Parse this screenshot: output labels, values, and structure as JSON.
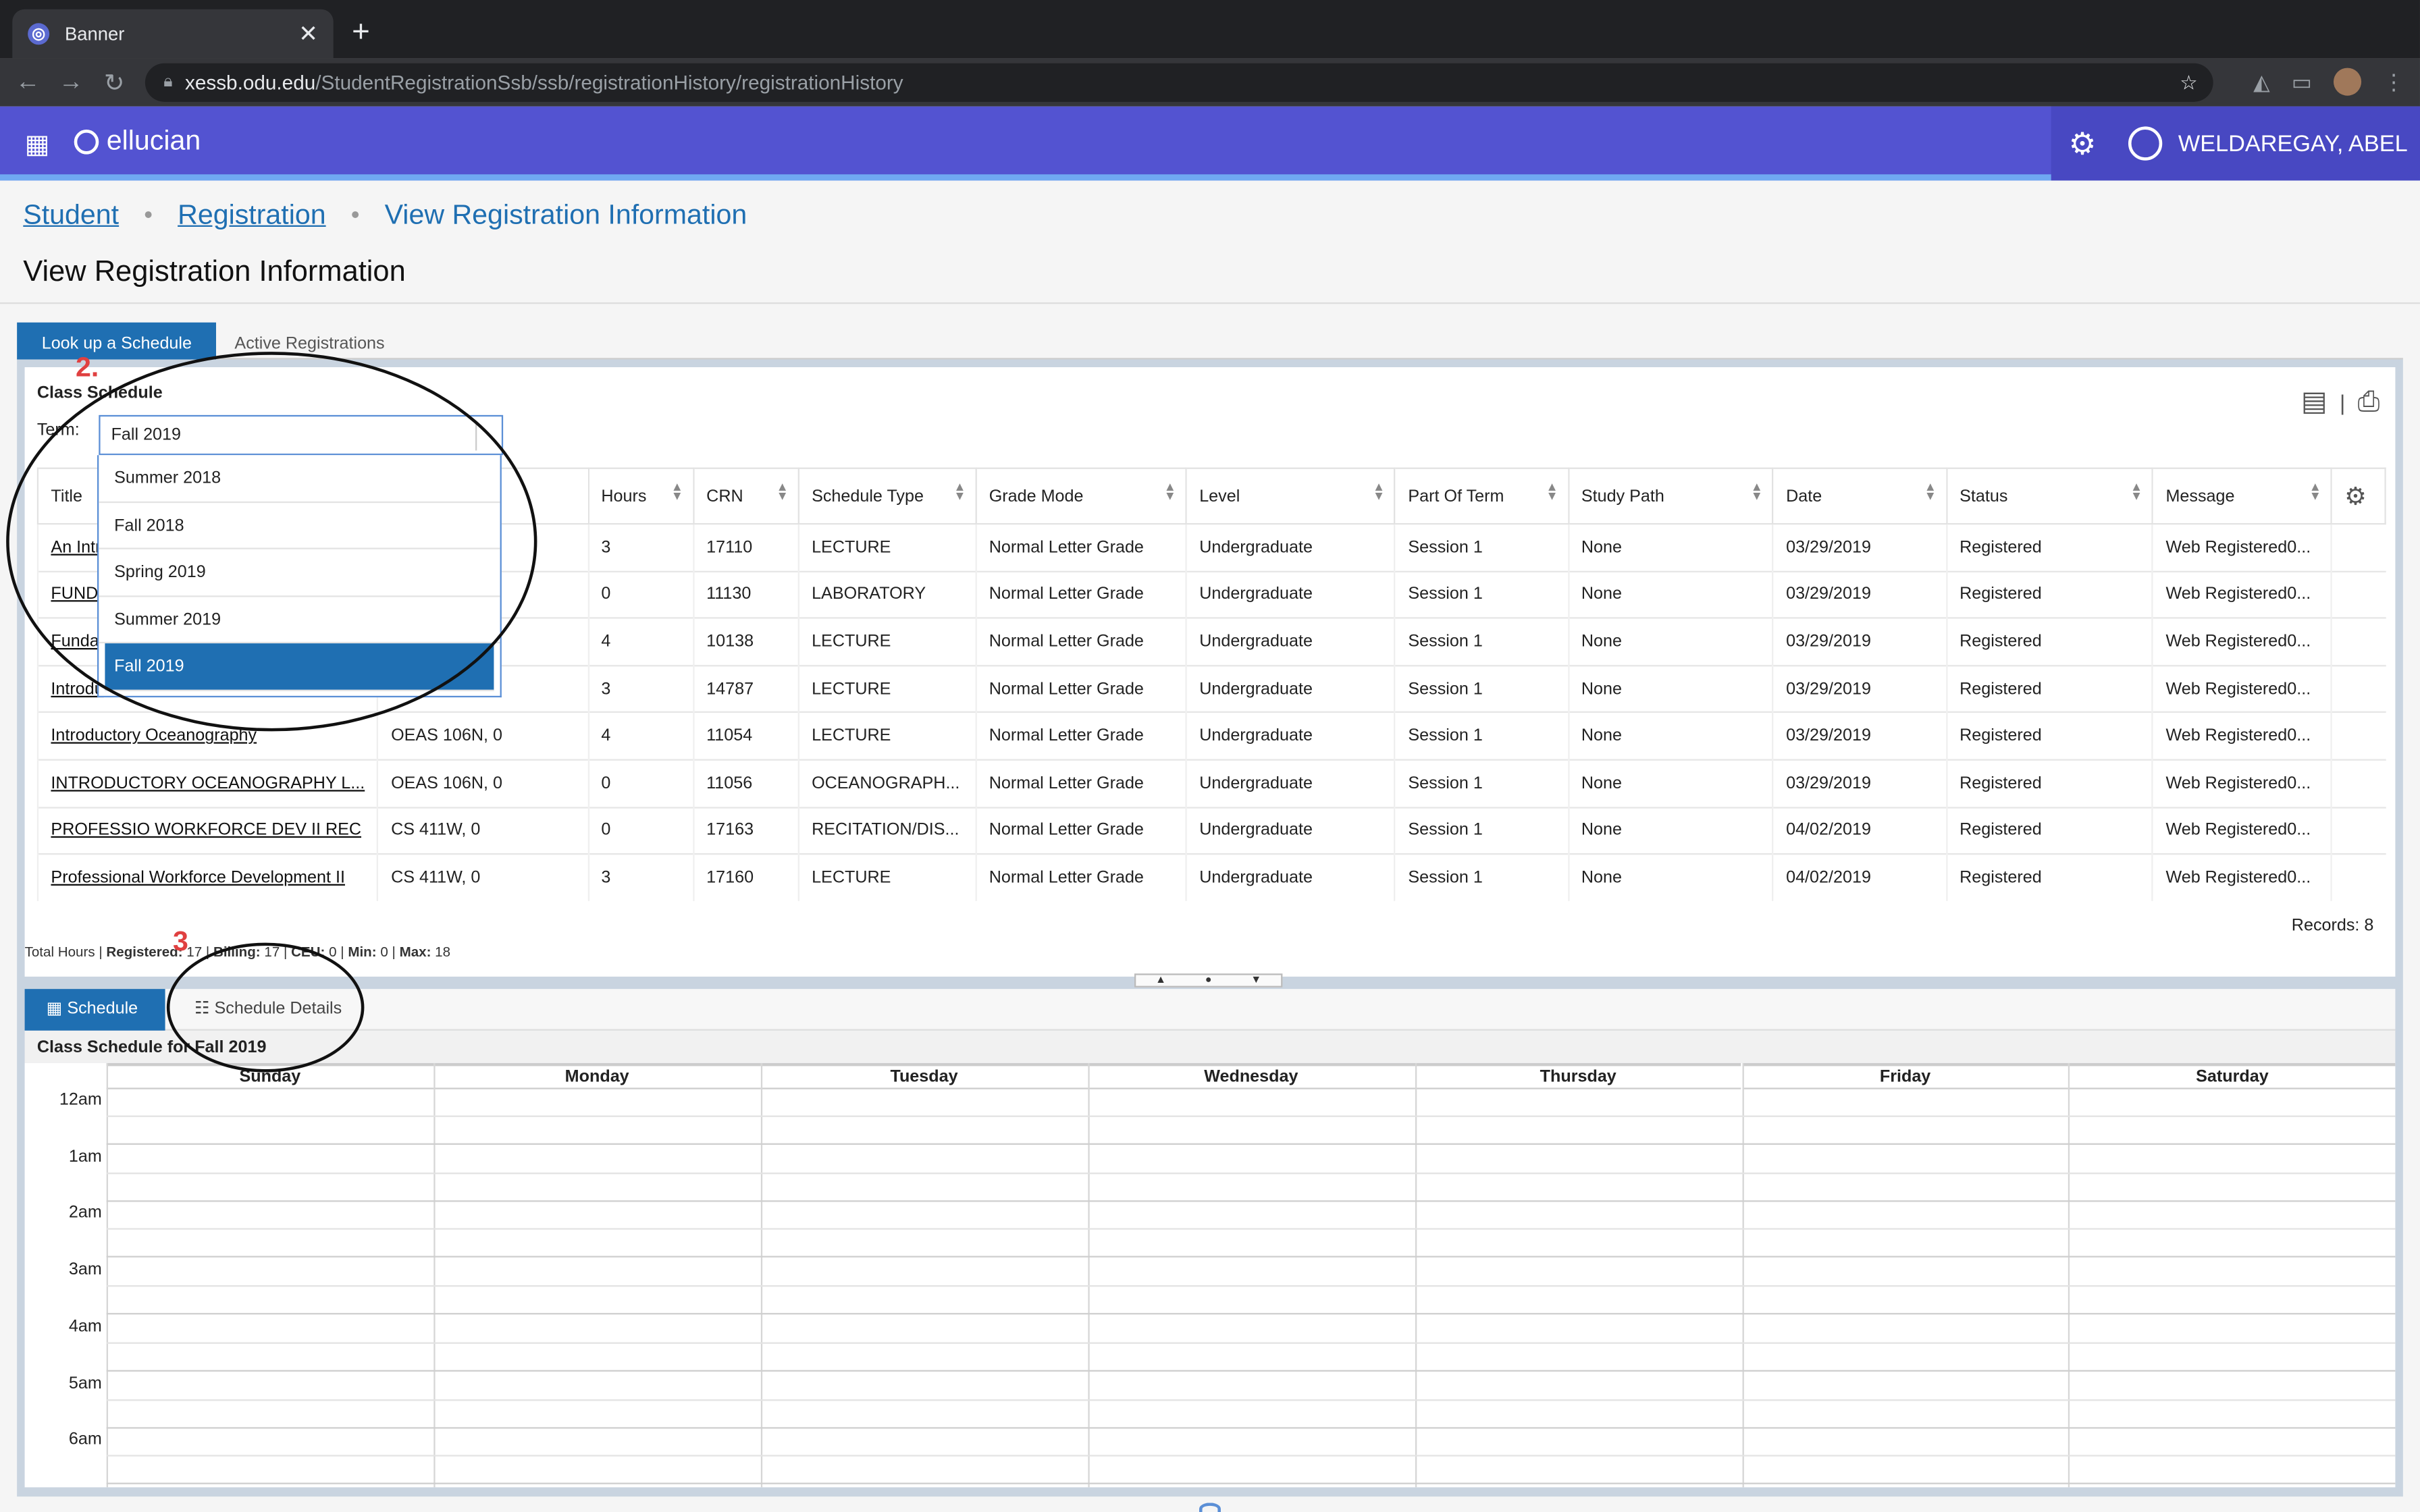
{
  "browser": {
    "tab_title": "Banner",
    "tab_close": "✕",
    "new_tab": "+",
    "url_host": "xessb.odu.edu",
    "url_path": "/StudentRegistrationSsb/ssb/registrationHistory/registrationHistory"
  },
  "app": {
    "brand": "ellucian",
    "user_name": "WELDAREGAY, ABEL"
  },
  "breadcrumb": {
    "student": "Student",
    "registration": "Registration",
    "current": "View Registration Information"
  },
  "page_title": "View Registration Information",
  "tabs": {
    "lookup": "Look up a Schedule",
    "active": "Active Registrations"
  },
  "class_schedule": {
    "label": "Class Schedule",
    "term_label": "Term:",
    "term_value": "Fall 2019",
    "term_options": [
      "Summer 2018",
      "Fall 2018",
      "Spring 2019",
      "Summer 2019",
      "Fall 2019"
    ],
    "columns": [
      "Title",
      "",
      "Hours",
      "CRN",
      "Schedule Type",
      "Grade Mode",
      "Level",
      "Part Of Term",
      "Study Path",
      "Date",
      "Status",
      "Message"
    ],
    "rows": [
      {
        "title": "An Intro",
        "details": "",
        "hours": "3",
        "crn": "17110",
        "type": "LECTURE",
        "grade": "Normal Letter Grade",
        "level": "Undergraduate",
        "part": "Session 1",
        "path": "None",
        "date": "03/29/2019",
        "status": "Registered",
        "message": "Web Registered0..."
      },
      {
        "title": "FUND (",
        "details": "",
        "hours": "0",
        "crn": "11130",
        "type": "LABORATORY",
        "grade": "Normal Letter Grade",
        "level": "Undergraduate",
        "part": "Session 1",
        "path": "None",
        "date": "03/29/2019",
        "status": "Registered",
        "message": "Web Registered0..."
      },
      {
        "title": "Fundar",
        "details": "",
        "hours": "4",
        "crn": "10138",
        "type": "LECTURE",
        "grade": "Normal Letter Grade",
        "level": "Undergraduate",
        "part": "Session 1",
        "path": "None",
        "date": "03/29/2019",
        "status": "Registered",
        "message": "Web Registered0..."
      },
      {
        "title": "Introdu",
        "details": "",
        "hours": "3",
        "crn": "14787",
        "type": "LECTURE",
        "grade": "Normal Letter Grade",
        "level": "Undergraduate",
        "part": "Session 1",
        "path": "None",
        "date": "03/29/2019",
        "status": "Registered",
        "message": "Web Registered0..."
      },
      {
        "title": "Introductory Oceanography",
        "details": "OEAS 106N, 0",
        "hours": "4",
        "crn": "11054",
        "type": "LECTURE",
        "grade": "Normal Letter Grade",
        "level": "Undergraduate",
        "part": "Session 1",
        "path": "None",
        "date": "03/29/2019",
        "status": "Registered",
        "message": "Web Registered0..."
      },
      {
        "title": "INTRODUCTORY OCEANOGRAPHY L...",
        "details": "OEAS 106N, 0",
        "hours": "0",
        "crn": "11056",
        "type": "OCEANOGRAPH...",
        "grade": "Normal Letter Grade",
        "level": "Undergraduate",
        "part": "Session 1",
        "path": "None",
        "date": "03/29/2019",
        "status": "Registered",
        "message": "Web Registered0..."
      },
      {
        "title": "PROFESSIO WORKFORCE DEV II REC",
        "details": "CS 411W, 0",
        "hours": "0",
        "crn": "17163",
        "type": "RECITATION/DIS...",
        "grade": "Normal Letter Grade",
        "level": "Undergraduate",
        "part": "Session 1",
        "path": "None",
        "date": "04/02/2019",
        "status": "Registered",
        "message": "Web Registered0..."
      },
      {
        "title": "Professional Workforce Development II",
        "details": "CS 411W, 0",
        "hours": "3",
        "crn": "17160",
        "type": "LECTURE",
        "grade": "Normal Letter Grade",
        "level": "Undergraduate",
        "part": "Session 1",
        "path": "None",
        "date": "04/02/2019",
        "status": "Registered",
        "message": "Web Registered0..."
      }
    ],
    "records": "Records: 8",
    "totals": {
      "total_hours": "Total Hours | ",
      "registered_label": "Registered:",
      "registered_value": " 17 | ",
      "billing_label": "Billing:",
      "billing_value": " 17 | ",
      "ceu_label": "CEU:",
      "ceu_value": " 0 | ",
      "min_label": "Min:",
      "min_value": " 0 | ",
      "max_label": "Max:",
      "max_value": " 18"
    }
  },
  "lower": {
    "tab_schedule": "Schedule",
    "tab_details": "Schedule Details",
    "title": "Class Schedule for Fall 2019",
    "days": [
      "Sunday",
      "Monday",
      "Tuesday",
      "Wednesday",
      "Thursday",
      "Friday",
      "Saturday"
    ],
    "hours": [
      "12am",
      "1am",
      "2am",
      "3am",
      "4am",
      "5am",
      "6am"
    ]
  },
  "annotations": {
    "two": "2.",
    "three": "3"
  }
}
